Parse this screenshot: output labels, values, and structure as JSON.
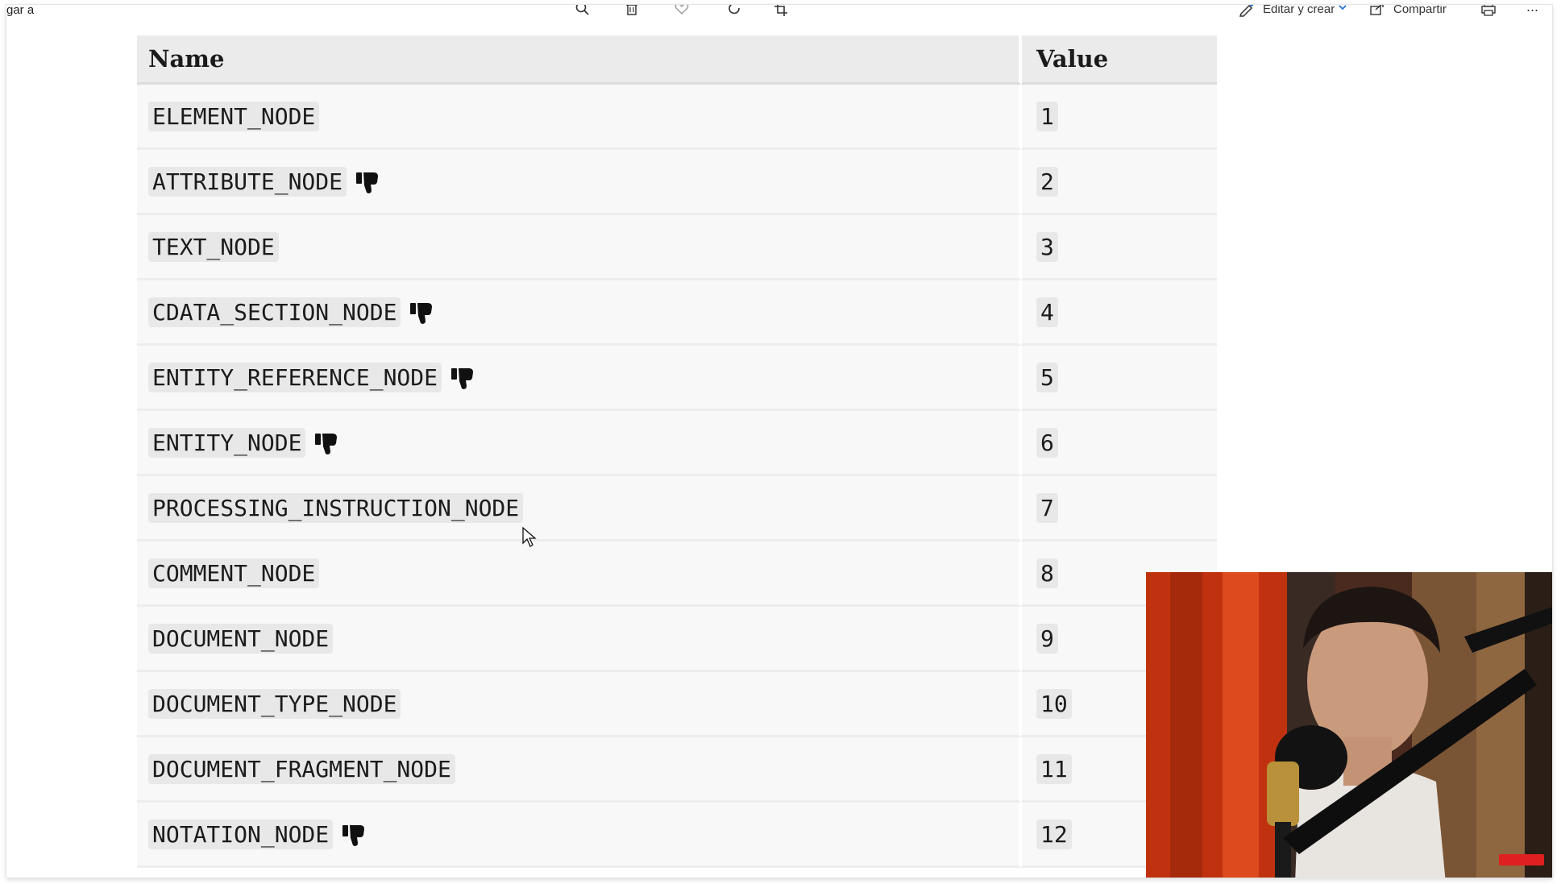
{
  "toolbar": {
    "left_text": "gar a",
    "edit_label": "Editar y crear",
    "share_label": "Compartir",
    "more_label": "..."
  },
  "table": {
    "headers": {
      "name": "Name",
      "value": "Value"
    },
    "rows": [
      {
        "name": "ELEMENT_NODE",
        "value": "1",
        "deprecated": false
      },
      {
        "name": "ATTRIBUTE_NODE",
        "value": "2",
        "deprecated": true
      },
      {
        "name": "TEXT_NODE",
        "value": "3",
        "deprecated": false
      },
      {
        "name": "CDATA_SECTION_NODE",
        "value": "4",
        "deprecated": true
      },
      {
        "name": "ENTITY_REFERENCE_NODE",
        "value": "5",
        "deprecated": true
      },
      {
        "name": "ENTITY_NODE",
        "value": "6",
        "deprecated": true
      },
      {
        "name": "PROCESSING_INSTRUCTION_NODE",
        "value": "7",
        "deprecated": false
      },
      {
        "name": "COMMENT_NODE",
        "value": "8",
        "deprecated": false
      },
      {
        "name": "DOCUMENT_NODE",
        "value": "9",
        "deprecated": false
      },
      {
        "name": "DOCUMENT_TYPE_NODE",
        "value": "10",
        "deprecated": false
      },
      {
        "name": "DOCUMENT_FRAGMENT_NODE",
        "value": "11",
        "deprecated": false
      },
      {
        "name": "NOTATION_NODE",
        "value": "12",
        "deprecated": true
      }
    ]
  },
  "icons": {
    "deprecated": "thumbs-down-icon",
    "toolbar": [
      "search-icon",
      "trash-icon",
      "heart-icon",
      "rotate-icon",
      "crop-icon",
      "edit-create-icon",
      "share-icon",
      "print-icon",
      "more-icon"
    ]
  },
  "colors": {
    "header_bg": "#ebebeb",
    "row_bg": "#f8f8f8",
    "code_bg": "#e8e8e8",
    "text": "#1b1b1b",
    "accent": "#2b6fd6"
  }
}
